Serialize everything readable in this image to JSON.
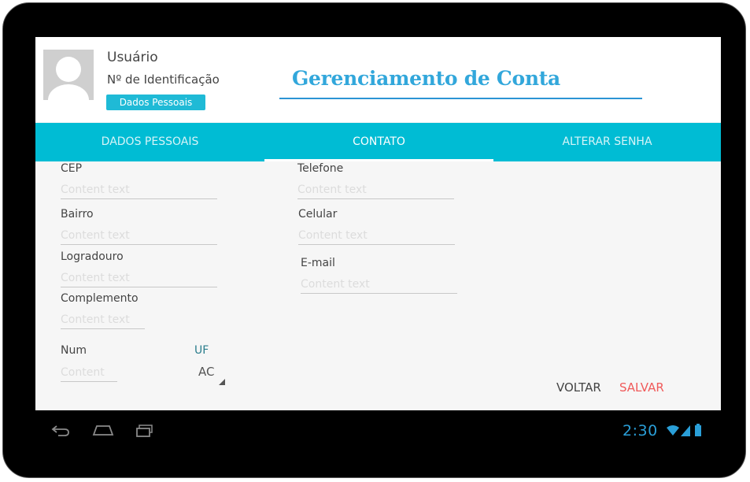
{
  "header": {
    "user_name": "Usuário",
    "user_id": "Nº de Identificação",
    "profile_button": "Dados Pessoais",
    "page_title": "Gerenciamento de Conta"
  },
  "tabs": [
    {
      "label": "DADOS PESSOAIS",
      "active": false
    },
    {
      "label": "CONTATO",
      "active": true
    },
    {
      "label": "ALTERAR SENHA",
      "active": false
    }
  ],
  "form": {
    "cep": {
      "label": "CEP",
      "placeholder": "Content text"
    },
    "bairro": {
      "label": "Bairro",
      "placeholder": "Content text"
    },
    "logradouro": {
      "label": "Logradouro",
      "placeholder": "Content text"
    },
    "complemento": {
      "label": "Complemento",
      "placeholder": "Content text"
    },
    "num": {
      "label": "Num",
      "placeholder": "Content"
    },
    "uf": {
      "label": "UF",
      "value": "AC"
    },
    "telefone": {
      "label": "Telefone",
      "placeholder": "Content text"
    },
    "celular": {
      "label": "Celular",
      "placeholder": "Content text"
    },
    "email": {
      "label": "E-mail",
      "placeholder": "Content text"
    }
  },
  "actions": {
    "back": "VOLTAR",
    "save": "SALVAR"
  },
  "system": {
    "time": "2:30",
    "icons": [
      "back-icon",
      "home-icon",
      "recent-apps-icon",
      "wifi-icon",
      "signal-icon",
      "battery-icon"
    ]
  },
  "colors": {
    "accent": "#00bcd4",
    "title": "#32a7db",
    "save": "#f05a5a",
    "clock": "#2a9fd8"
  }
}
